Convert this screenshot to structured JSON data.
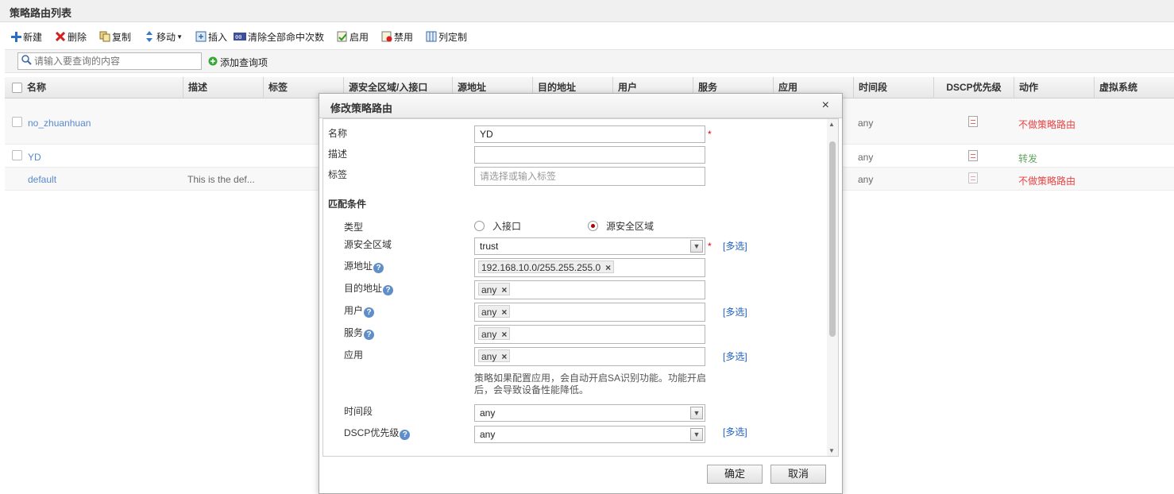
{
  "header": {
    "title": "策略路由列表"
  },
  "toolbar": {
    "new": "新建",
    "delete": "删除",
    "copy": "复制",
    "move": "移动",
    "insert": "插入",
    "clear_hits": "清除全部命中次数",
    "enable": "启用",
    "disable": "禁用",
    "customize": "列定制"
  },
  "search": {
    "placeholder": "请输入要查询的内容",
    "add_query": "添加查询项"
  },
  "table": {
    "columns": [
      "名称",
      "描述",
      "标签",
      "源安全区域/入接口",
      "源地址",
      "目的地址",
      "用户",
      "服务",
      "应用",
      "时间段",
      "DSCP优先级",
      "动作",
      "虚拟系统"
    ],
    "rows": [
      {
        "name": "no_zhuanhuan",
        "desc": "",
        "time": "any",
        "action": "不做策略路由"
      },
      {
        "name": "YD",
        "desc": "",
        "time": "any",
        "action": "转发"
      },
      {
        "name": "default",
        "desc": "This is the def...",
        "time": "any",
        "action": "不做策略路由"
      }
    ]
  },
  "dialog": {
    "title": "修改策略路由",
    "close": "×",
    "name_label": "名称",
    "name_value": "YD",
    "desc_label": "描述",
    "desc_value": "",
    "tag_label": "标签",
    "tag_placeholder": "请选择或输入标签",
    "section_match": "匹配条件",
    "type_label": "类型",
    "type_opt1": "入接口",
    "type_opt2": "源安全区域",
    "src_zone_label": "源安全区域",
    "src_zone_value": "trust",
    "src_addr_label": "源地址",
    "src_addr_value": "192.168.10.0/255.255.255.0",
    "dst_addr_label": "目的地址",
    "dst_addr_value": "any",
    "user_label": "用户",
    "user_value": "any",
    "service_label": "服务",
    "service_value": "any",
    "app_label": "应用",
    "app_value": "any",
    "app_note_line1": "策略如果配置应用，会自动开启SA识别功能。功能开启",
    "app_note_line2": "后，会导致设备性能降低。",
    "time_label": "时间段",
    "time_value": "any",
    "dscp_label": "DSCP优先级",
    "dscp_value": "any",
    "multi_select": "[多选]",
    "help": "?",
    "required": "*",
    "ok": "确定",
    "cancel": "取消"
  },
  "colors": {
    "link": "#1f5fbf",
    "danger": "#e00000",
    "success": "#2a8a2a",
    "radio_on": "#b00000"
  }
}
